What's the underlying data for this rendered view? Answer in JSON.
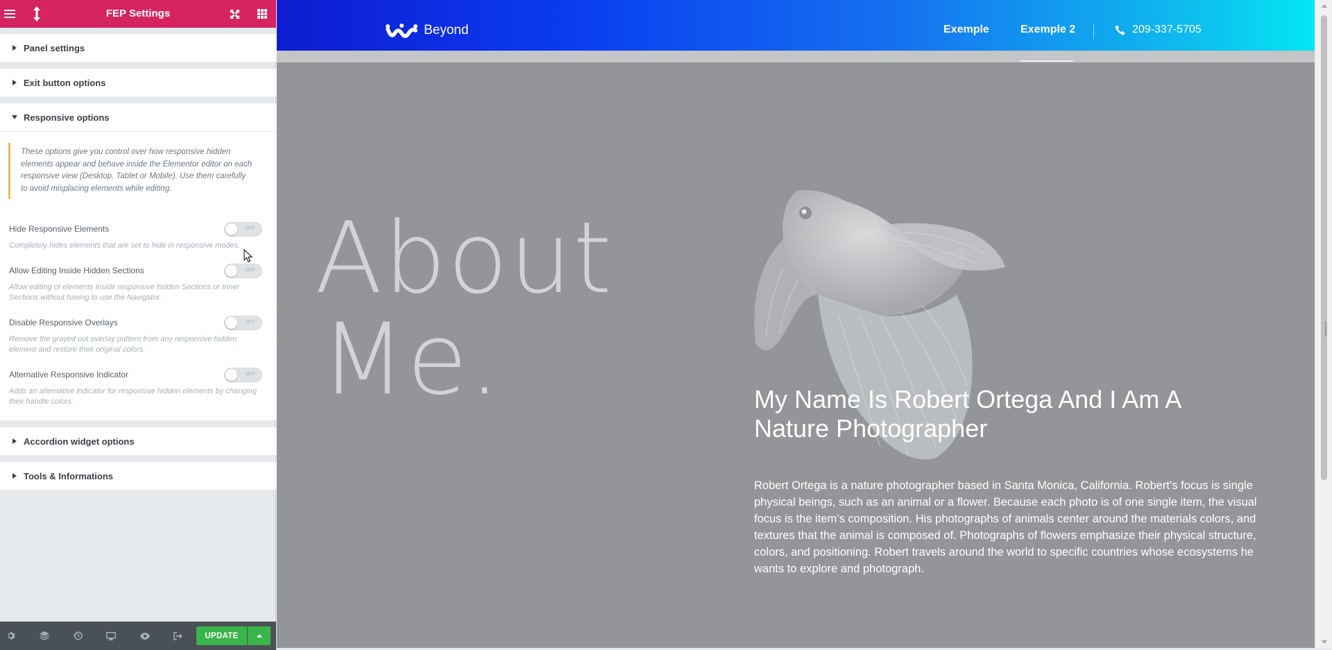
{
  "panel": {
    "title": "FEP Settings",
    "sections": {
      "panel_settings": "Panel settings",
      "exit_button": "Exit button options",
      "responsive": "Responsive options",
      "accordion": "Accordion widget options",
      "tools": "Tools & Informations"
    },
    "responsive_note": "These options give you control over how responsive hidden elements appear and behave inside the Elementor editor on each responsive view (Desktop, Tablet or Mobile). Use them carefully to avoid misplacing elements while editing.",
    "controls": [
      {
        "label": "Hide Responsive Elements",
        "state": "OFF",
        "desc": "Completely hides elements that are set to hide in responsive modes."
      },
      {
        "label": "Allow Editing Inside Hidden Sections",
        "state": "OFF",
        "desc": "Allow editing of elements inside responsive hidden Sections or Inner Sections without having to use the Navigator."
      },
      {
        "label": "Disable Responsive Overlays",
        "state": "OFF",
        "desc": "Remove the grayed out overlay pattern from any responsive hidden element and restore their original colors."
      },
      {
        "label": "Alternative Responsive Indicator",
        "state": "OFF",
        "desc": "Adds an alternative indicator for responsive hidden elements by changing their handle colors."
      }
    ],
    "footer": {
      "update_label": "UPDATE"
    }
  },
  "site": {
    "brand": "Beyond",
    "nav": [
      "Exemple",
      "Exemple 2"
    ],
    "phone": "209-337-5705",
    "about_line1": "About",
    "about_line2": "Me.",
    "headline": "My Name Is Robert Ortega And I Am A Nature Photographer",
    "bio": "Robert Ortega is a nature photographer based in Santa Monica, California. Robert’s focus is single physical beings, such as an animal or a flower. Because each photo is of one single item, the visual focus is the item’s composition. His photographs of animals center around the materials colors, and textures that the animal is composed of. Photographs of flowers emphasize their physical structure, colors, and positioning. Robert travels around the world to specific countries whose ecosystems he wants to explore and photograph."
  },
  "colors": {
    "panel_header": "#d5245f",
    "update_button": "#39b54a",
    "note_border": "#f0b849",
    "preview_bg": "#939598"
  },
  "icons": [
    "hamburger-icon",
    "responsive-arrows-icon",
    "fullscreen-icon",
    "grid-icon",
    "caret-right-icon",
    "caret-down-icon",
    "gear-icon",
    "layers-icon",
    "history-icon",
    "desktop-icon",
    "eye-icon",
    "exit-icon",
    "caret-up-icon",
    "chevron-left-icon",
    "logo-icon",
    "phone-icon"
  ]
}
